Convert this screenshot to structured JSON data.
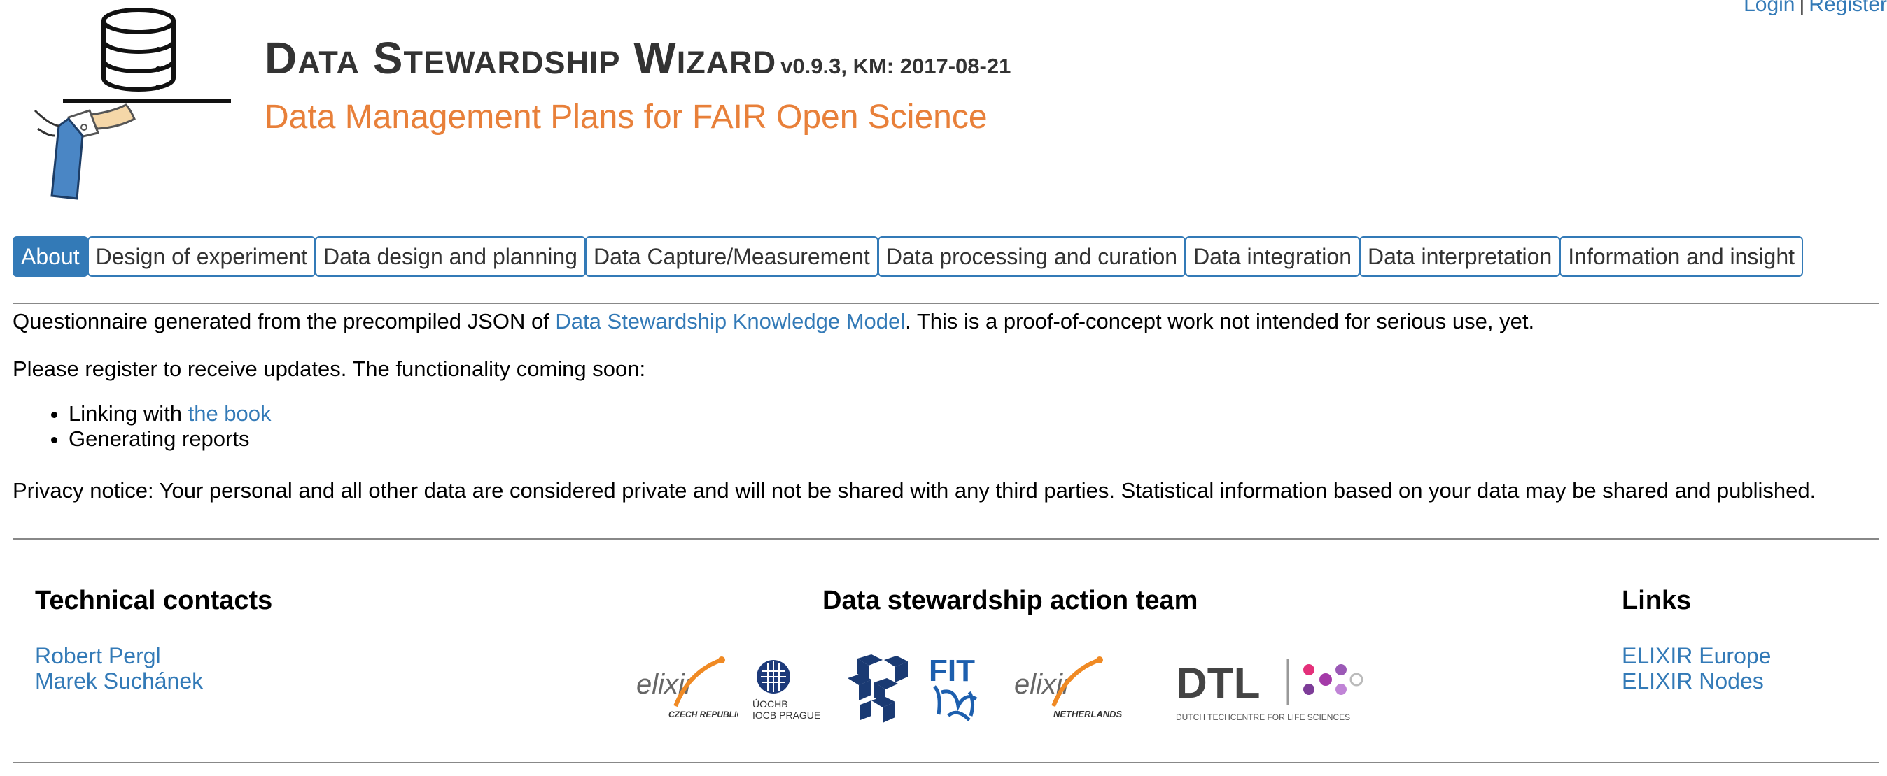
{
  "auth": {
    "login": "Login",
    "separator": "|",
    "register": "Register"
  },
  "header": {
    "title": "Data Stewardship Wizard",
    "version": "v0.9.3, KM: 2017-08-21",
    "subtitle": "Data Management Plans for FAIR Open Science"
  },
  "tabs": [
    {
      "label": "About",
      "active": true
    },
    {
      "label": "Design of experiment"
    },
    {
      "label": "Data design and planning"
    },
    {
      "label": "Data Capture/Measurement"
    },
    {
      "label": "Data processing and curation"
    },
    {
      "label": "Data integration"
    },
    {
      "label": "Data interpretation"
    },
    {
      "label": "Information and insight"
    }
  ],
  "about": {
    "intro_prefix": "Questionnaire generated from the precompiled JSON of ",
    "intro_link": "Data Stewardship Knowledge Model",
    "intro_suffix": ". This is a proof-of-concept work not intended for serious use, yet.",
    "register_text": "Please register to receive updates. The functionality coming soon:",
    "features": [
      {
        "prefix": "Linking with ",
        "link": "the book"
      },
      {
        "prefix": "Generating reports",
        "link": ""
      }
    ],
    "privacy": "Privacy notice: Your personal and all other data are considered private and will not be shared with any third parties. Statistical information based on your data may be shared and published."
  },
  "footer": {
    "contacts": {
      "heading": "Technical contacts",
      "people": [
        "Robert Pergl",
        "Marek Suchánek"
      ]
    },
    "team": {
      "heading": "Data stewardship action team",
      "logos": [
        {
          "text": "elixir",
          "sub": "CZECH REPUBLIC"
        },
        {
          "text": "ÚOCHB",
          "sub": "IOCB PRAGUE"
        },
        {
          "text": "",
          "sub": ""
        },
        {
          "text": "FIT",
          "sub": ""
        },
        {
          "text": "elixir",
          "sub": "NETHERLANDS"
        },
        {
          "text": "DTL",
          "sub": "DUTCH TECHCENTRE FOR LIFE SCIENCES"
        }
      ]
    },
    "links": {
      "heading": "Links",
      "items": [
        "ELIXIR Europe",
        "ELIXIR Nodes"
      ]
    }
  },
  "colors": {
    "link": "#337ab7",
    "accent_orange": "#e8803a",
    "tab_active": "#337ab7"
  }
}
